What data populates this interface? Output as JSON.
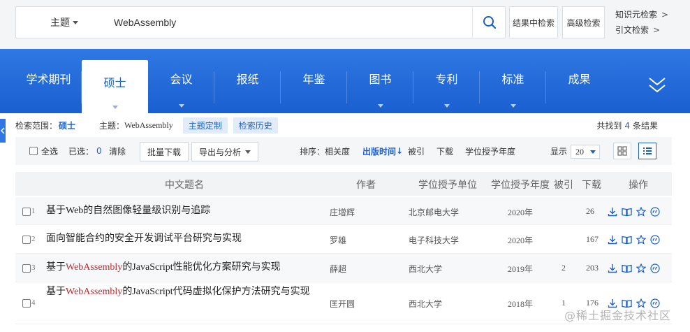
{
  "search": {
    "field_label": "主题",
    "query": "WebAssembly",
    "result_search_label": "结果中检索",
    "advanced_label": "高级检索",
    "side_links": [
      "知识元检索",
      "引文检索"
    ],
    "side_arrow": ">"
  },
  "nav": {
    "tabs": [
      "学术期刊",
      "硕士",
      "会议",
      "报纸",
      "年鉴",
      "图书",
      "专利",
      "标准",
      "成果"
    ],
    "active_index": 1,
    "accent_color": "#1a5fd0"
  },
  "filter": {
    "scope_label": "检索范围：",
    "scope_value": "硕士",
    "topic_label": "主题：",
    "topic_value": "WebAssembly",
    "chips": [
      "主题定制",
      "检索历史"
    ],
    "found_prefix": "共找到",
    "found_count": "4",
    "found_suffix": "条结果"
  },
  "toolbar": {
    "select_all": "全选",
    "selected_label": "已选：",
    "selected_count": "0",
    "clear": "清除",
    "batch_download": "批量下载",
    "export": "导出与分析",
    "sort_label": "排序：",
    "sort_options": [
      "相关度",
      "出版时间",
      "被引",
      "下载",
      "学位授予年度"
    ],
    "sort_active": "出版时间",
    "sort_active_arrow": "↓",
    "display_label": "显示",
    "page_size": "20"
  },
  "table": {
    "headers": [
      "中文题名",
      "作者",
      "学位授予单位",
      "学位授予年度",
      "被引",
      "下载",
      "操作"
    ],
    "rows": [
      {
        "num": "1",
        "title_parts": [
          {
            "t": "基于Web的自然图像轻量级识别与追踪",
            "hl": false
          }
        ],
        "author": "庄增辉",
        "unit": "北京邮电大学",
        "year": "2020年",
        "cite": "",
        "download": "26"
      },
      {
        "num": "2",
        "title_parts": [
          {
            "t": "面向智能合约的安全开发调试平台研究与实现",
            "hl": false
          }
        ],
        "author": "罗雄",
        "unit": "电子科技大学",
        "year": "2020年",
        "cite": "",
        "download": "167"
      },
      {
        "num": "3",
        "title_parts": [
          {
            "t": "基于",
            "hl": false
          },
          {
            "t": "WebAssembly",
            "hl": true
          },
          {
            "t": "的JavaScript性能优化方案研究与实现",
            "hl": false
          }
        ],
        "author": "薛超",
        "unit": "西北大学",
        "year": "2019年",
        "cite": "2",
        "download": "203"
      },
      {
        "num": "4",
        "title_parts": [
          {
            "t": "基于",
            "hl": false
          },
          {
            "t": "WebAssembly",
            "hl": true
          },
          {
            "t": "的JavaScript代码虚拟化保护方法研究与实现",
            "hl": false
          }
        ],
        "author": "匡开圆",
        "unit": "西北大学",
        "year": "2018年",
        "cite": "1",
        "download": "176"
      }
    ]
  },
  "watermark": "@稀土掘金技术社区",
  "highlight_color": "#c0282d"
}
